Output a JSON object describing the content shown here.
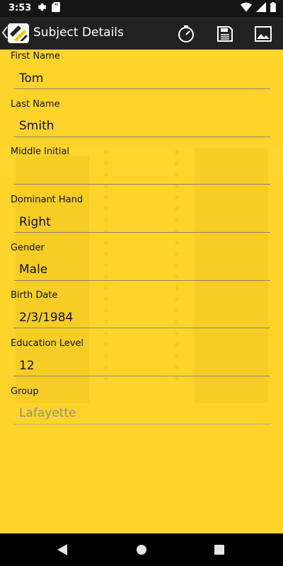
{
  "status_bar": {
    "time": "3:53"
  },
  "app_bar": {
    "title": "Subject Details"
  },
  "form": {
    "fields": [
      {
        "label": "First Name",
        "value": "Tom"
      },
      {
        "label": "Last Name",
        "value": "Smith"
      },
      {
        "label": "Middle Initial",
        "value": ""
      },
      {
        "label": "Dominant Hand",
        "value": "Right"
      },
      {
        "label": "Gender",
        "value": "Male"
      },
      {
        "label": "Birth Date",
        "value": "2/3/1984"
      },
      {
        "label": "Education Level",
        "value": "12"
      },
      {
        "label": "Group",
        "value": "Lafayette"
      }
    ]
  },
  "colors": {
    "background": "#ffd42a",
    "app_bar": "#212121",
    "status_bar": "#151515",
    "nav_bar": "#000000"
  },
  "icons": [
    "settings-icon",
    "sd-card-icon",
    "wifi-icon",
    "signal-icon",
    "battery-icon",
    "timer-icon",
    "save-icon",
    "image-icon"
  ]
}
